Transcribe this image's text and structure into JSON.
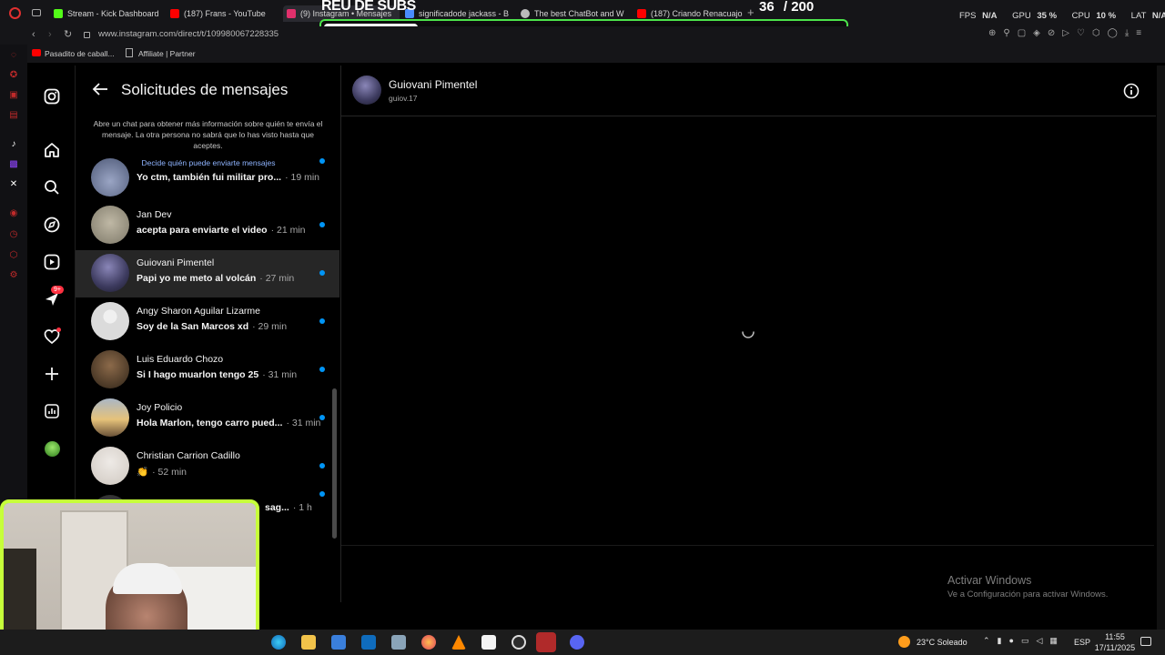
{
  "browser": {
    "tabs": [
      {
        "label": "Stream - Kick Dashboard",
        "color": "#53fc18"
      },
      {
        "label": "(187) Frans - YouTube",
        "color": "#ff0000"
      },
      {
        "label": "(9) Instagram • Mensajes",
        "color": "#e1306c"
      },
      {
        "label": "significadode jackass - B",
        "color": "#4a8cff"
      },
      {
        "label": "The best ChatBot and W",
        "color": "#bbbbbb"
      },
      {
        "label": "(187) Criando Renacuajos",
        "color": "#ff0000"
      }
    ],
    "url": "www.instagram.com/direct/t/109980067228335",
    "stats": {
      "fps_label": "FPS",
      "fps_value": "N/A",
      "gpu_label": "GPU",
      "gpu_value": "35 %",
      "cpu_label": "CPU",
      "cpu_value": "10 %",
      "lat_label": "LAT",
      "lat_value": "N/A"
    },
    "bookmarks": [
      "Pasadito de caball...",
      "Affiliate | Partner"
    ]
  },
  "overlay": {
    "title": "REU DE SUBS",
    "current": "36",
    "goal": "/ 200",
    "progress_fraction": 0.18
  },
  "requests": {
    "title": "Solicitudes de mensajes",
    "info": "Abre un chat para obtener más información sobre quién te envía el mensaje. La otra persona no sabrá que lo has visto hasta que aceptes.",
    "link": "Decide quién puede enviarte mensajes",
    "items": [
      {
        "name": "",
        "message": "Yo ctm, también fui militar pro...",
        "time": "· 19 min"
      },
      {
        "name": "Jan Dev",
        "message": "acepta para enviarte el video",
        "time": "· 21 min"
      },
      {
        "name": "Guiovani Pimentel",
        "message": "Papi yo me meto al volcán",
        "time": "· 27 min"
      },
      {
        "name": "Angy Sharon Aguilar Lizarme",
        "message": "Soy de la San Marcos xd",
        "time": "· 29 min"
      },
      {
        "name": "Luis Eduardo Chozo",
        "message": "Si I hago muarlon tengo 25",
        "time": "· 31 min"
      },
      {
        "name": "Joy Policio",
        "message": "Hola Marlon, tengo carro pued...",
        "time": "· 31 min"
      },
      {
        "name": "Christian Carrion Cadillo",
        "message": "👏",
        "time": "· 52 min"
      },
      {
        "name": "",
        "message": "sag...",
        "time": "· 1 h"
      }
    ]
  },
  "notification_badge": "9+",
  "chat": {
    "name": "Guiovani Pimentel",
    "username": "guiov.17"
  },
  "windows": {
    "activate_title": "Activar Windows",
    "activate_sub": "Ve a Configuración para activar Windows.",
    "weather": "23°C  Soleado",
    "lang": "ESP",
    "time": "11:55",
    "date": "17/11/2025"
  }
}
